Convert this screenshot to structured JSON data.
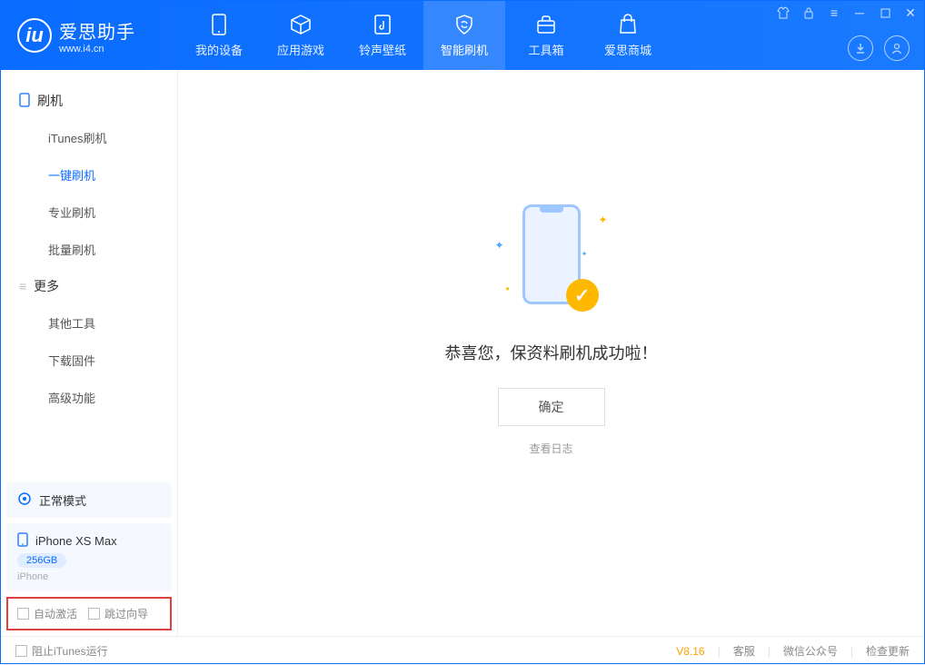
{
  "brand": {
    "title": "爱思助手",
    "subtitle": "www.i4.cn"
  },
  "tabs": {
    "device": "我的设备",
    "apps": "应用游戏",
    "ringtone": "铃声壁纸",
    "flash": "智能刷机",
    "toolbox": "工具箱",
    "store": "爱思商城"
  },
  "sidebar": {
    "section1": "刷机",
    "itunes": "iTunes刷机",
    "oneclick": "一键刷机",
    "pro": "专业刷机",
    "batch": "批量刷机",
    "section2": "更多",
    "other": "其他工具",
    "firmware": "下载固件",
    "advanced": "高级功能"
  },
  "device": {
    "mode": "正常模式",
    "name": "iPhone XS Max",
    "capacity": "256GB",
    "type": "iPhone"
  },
  "options": {
    "autoactivate": "自动激活",
    "skipwizard": "跳过向导"
  },
  "main": {
    "message": "恭喜您，保资料刷机成功啦！",
    "ok": "确定",
    "viewlog": "查看日志"
  },
  "footer": {
    "blockitunes": "阻止iTunes运行",
    "version": "V8.16",
    "support": "客服",
    "wechat": "微信公众号",
    "update": "检查更新"
  }
}
